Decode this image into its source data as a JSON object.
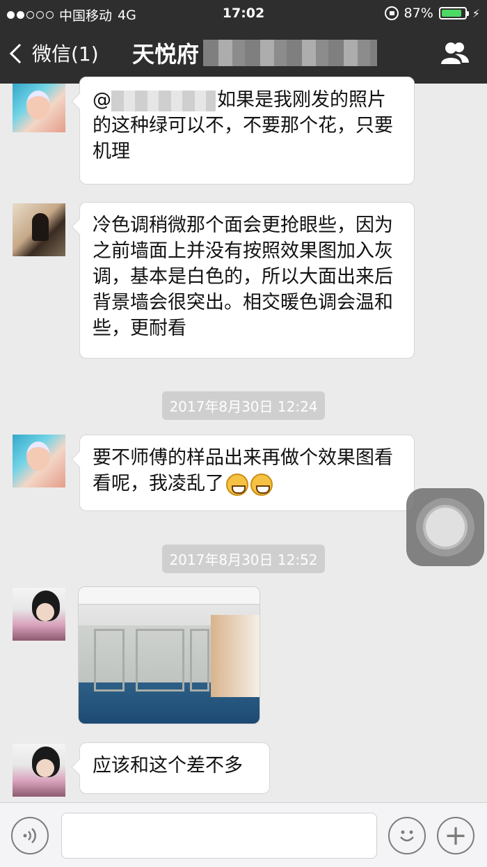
{
  "status_bar": {
    "carrier": "中国移动",
    "network": "4G",
    "time": "17:02",
    "battery": "87%",
    "battery_level": 0.87,
    "signal_bars": 2
  },
  "nav": {
    "back_label": "微信(1)",
    "title": "天悦府",
    "right_icon": "group-members-icon"
  },
  "messages": [
    {
      "id": "m1",
      "avatar": "baby-avatar",
      "text_prefix": "@",
      "text": "如果是我刚发的照片的这种绿可以不，不要那个花，只要机理"
    },
    {
      "id": "m2",
      "avatar": "woman-avatar",
      "text": "冷色调稍微那个面会更抢眼些，因为之前墙面上并没有按照效果图加入灰调，基本是白色的，所以大面出来后背景墙会很突出。相交暖色调会温和些，更耐看"
    },
    {
      "id": "t1",
      "timestamp": "2017年8月30日 12:24"
    },
    {
      "id": "m3",
      "avatar": "baby-avatar",
      "text": "要不师傅的样品出来再做个效果图看看呢，我凌乱了",
      "emojis": [
        "grin-emoji",
        "grin-emoji"
      ]
    },
    {
      "id": "t2",
      "timestamp": "2017年8月30日 12:52"
    },
    {
      "id": "m4",
      "avatar": "girl-avatar",
      "image": "room-photo"
    },
    {
      "id": "m5",
      "avatar": "girl-avatar",
      "text": "应该和这个差不多"
    }
  ],
  "input_bar": {
    "voice_icon": "voice-icon",
    "emoji_icon": "emoji-icon",
    "plus_icon": "plus-icon",
    "plus_glyph": "+"
  }
}
